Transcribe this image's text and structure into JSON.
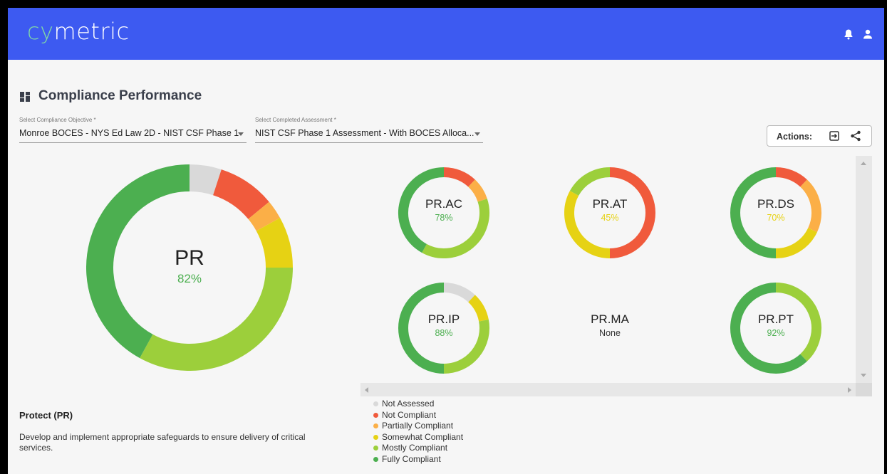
{
  "app": {
    "logo_prefix": "cy",
    "logo_suffix": "metric",
    "header_color": "#3d5af1",
    "logo_accent": "#7fd6a8"
  },
  "header_icons": [
    "bell-icon",
    "user-icon"
  ],
  "page": {
    "title": "Compliance Performance",
    "title_icon": "dashboard-icon"
  },
  "filters": {
    "objective": {
      "label": "Select Compliance Objective *",
      "value": "Monroe BOCES - NYS Ed Law 2D - NIST CSF Phase 1"
    },
    "assessment": {
      "label": "Select Completed Assessment *",
      "value": "NIST CSF Phase 1 Assessment - With BOCES Alloca..."
    }
  },
  "actions": {
    "label": "Actions:",
    "icons": [
      "export-icon",
      "share-icon"
    ]
  },
  "colors": {
    "not_assessed": "#d9d9d9",
    "not_compliant": "#f05a3c",
    "partially_compliant": "#fbaf47",
    "somewhat_compliant": "#e6d214",
    "mostly_compliant": "#9ccf3b",
    "fully_compliant": "#4caf50"
  },
  "main": {
    "name": "PR",
    "percent": "82%",
    "percent_color": "#4caf50",
    "segments": [
      {
        "status": "not_assessed",
        "value": 5
      },
      {
        "status": "not_compliant",
        "value": 9
      },
      {
        "status": "partially_compliant",
        "value": 3
      },
      {
        "status": "somewhat_compliant",
        "value": 8
      },
      {
        "status": "mostly_compliant",
        "value": 33
      },
      {
        "status": "fully_compliant",
        "value": 42
      }
    ]
  },
  "subcategories": [
    {
      "name": "PR.AC",
      "percent": "78%",
      "percent_color": "#4caf50",
      "segments": [
        {
          "status": "not_compliant",
          "value": 12
        },
        {
          "status": "partially_compliant",
          "value": 8
        },
        {
          "status": "mostly_compliant",
          "value": 38
        },
        {
          "status": "fully_compliant",
          "value": 42
        }
      ]
    },
    {
      "name": "PR.AT",
      "percent": "45%",
      "percent_color": "#e6d214",
      "segments": [
        {
          "status": "not_compliant",
          "value": 50
        },
        {
          "status": "somewhat_compliant",
          "value": 33
        },
        {
          "status": "mostly_compliant",
          "value": 17
        }
      ]
    },
    {
      "name": "PR.DS",
      "percent": "70%",
      "percent_color": "#e6d214",
      "segments": [
        {
          "status": "not_compliant",
          "value": 12
        },
        {
          "status": "partially_compliant",
          "value": 20
        },
        {
          "status": "somewhat_compliant",
          "value": 18
        },
        {
          "status": "fully_compliant",
          "value": 50
        }
      ]
    },
    {
      "name": "PR.IP",
      "percent": "88%",
      "percent_color": "#4caf50",
      "segments": [
        {
          "status": "not_assessed",
          "value": 12
        },
        {
          "status": "somewhat_compliant",
          "value": 10
        },
        {
          "status": "mostly_compliant",
          "value": 28
        },
        {
          "status": "fully_compliant",
          "value": 50
        }
      ]
    },
    {
      "name": "PR.MA",
      "percent": "None",
      "percent_color": "#333333",
      "segments": []
    },
    {
      "name": "PR.PT",
      "percent": "92%",
      "percent_color": "#4caf50",
      "segments": [
        {
          "status": "mostly_compliant",
          "value": 38
        },
        {
          "status": "fully_compliant",
          "value": 62
        }
      ]
    }
  ],
  "legend": [
    {
      "label": "Not Assessed",
      "status": "not_assessed"
    },
    {
      "label": "Not Compliant",
      "status": "not_compliant"
    },
    {
      "label": "Partially Compliant",
      "status": "partially_compliant"
    },
    {
      "label": "Somewhat Compliant",
      "status": "somewhat_compliant"
    },
    {
      "label": "Mostly Compliant",
      "status": "mostly_compliant"
    },
    {
      "label": "Fully Compliant",
      "status": "fully_compliant"
    }
  ],
  "description": {
    "title": "Protect (PR)",
    "text": "Develop and implement appropriate safeguards to ensure delivery of critical services."
  }
}
